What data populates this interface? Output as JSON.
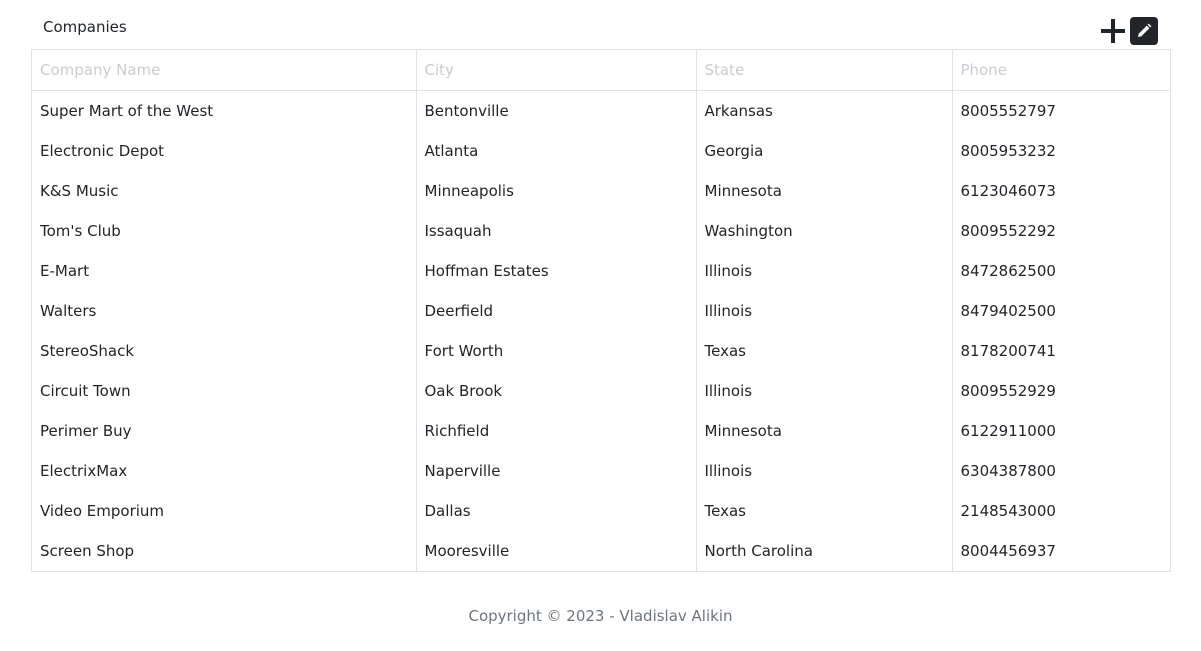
{
  "header": {
    "title": "Companies",
    "add_icon": "plus-icon",
    "edit_icon": "pencil-icon"
  },
  "table": {
    "columns": [
      "Company Name",
      "City",
      "State",
      "Phone"
    ],
    "rows": [
      [
        "Super Mart of the West",
        "Bentonville",
        "Arkansas",
        "8005552797"
      ],
      [
        "Electronic Depot",
        "Atlanta",
        "Georgia",
        "8005953232"
      ],
      [
        "K&S Music",
        "Minneapolis",
        "Minnesota",
        "6123046073"
      ],
      [
        "Tom's Club",
        "Issaquah",
        "Washington",
        "8009552292"
      ],
      [
        "E-Mart",
        "Hoffman Estates",
        "Illinois",
        "8472862500"
      ],
      [
        "Walters",
        "Deerfield",
        "Illinois",
        "8479402500"
      ],
      [
        "StereoShack",
        "Fort Worth",
        "Texas",
        "8178200741"
      ],
      [
        "Circuit Town",
        "Oak Brook",
        "Illinois",
        "8009552929"
      ],
      [
        "Perimer Buy",
        "Richfield",
        "Minnesota",
        "6122911000"
      ],
      [
        "ElectrixMax",
        "Naperville",
        "Illinois",
        "6304387800"
      ],
      [
        "Video Emporium",
        "Dallas",
        "Texas",
        "2148543000"
      ],
      [
        "Screen Shop",
        "Mooresville",
        "North Carolina",
        "8004456937"
      ]
    ]
  },
  "footer": {
    "copyright": "Copyright © 2023 - Vladislav Alikin"
  },
  "colors": {
    "text": "#212529",
    "header_text": "#c9cdd1",
    "border": "#dee2e6",
    "edit_button_bg": "#212529"
  }
}
